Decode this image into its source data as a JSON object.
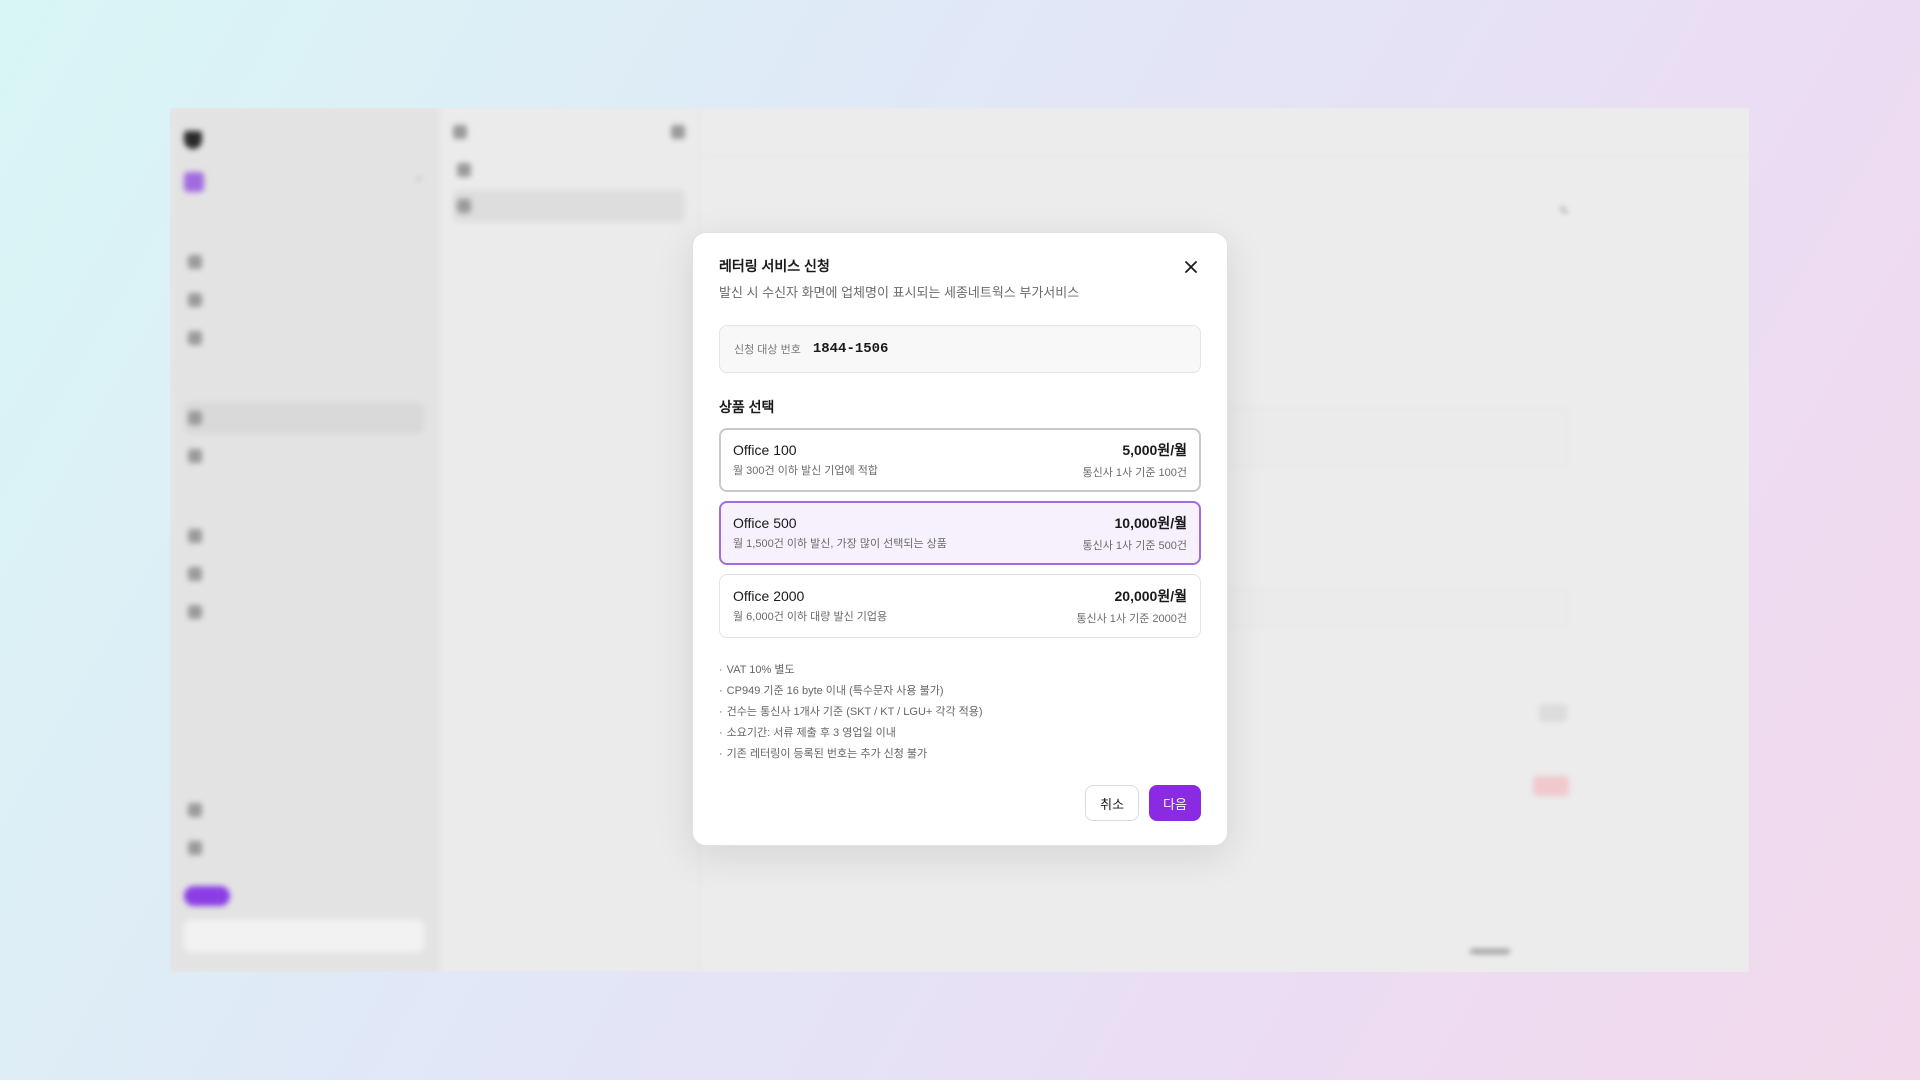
{
  "modal": {
    "title": "레터링 서비스 신청",
    "subtitle": "발신 시 수신자 화면에 업체명이 표시되는 세종네트웍스 부가서비스",
    "close_icon": "close-icon",
    "target_label": "신청 대상 번호",
    "target_number": "1844-1506",
    "section_title": "상품 선택",
    "plans": [
      {
        "name": "Office 100",
        "desc": "월 300건 이하 발신 기업에 적합",
        "price": "5,000원/월",
        "quota": "통신사 1사 기준 100건",
        "state": "focused"
      },
      {
        "name": "Office 500",
        "desc": "월 1,500건 이하 발신, 가장 많이 선택되는 상품",
        "price": "10,000원/월",
        "quota": "통신사 1사 기준 500건",
        "state": "selected"
      },
      {
        "name": "Office 2000",
        "desc": "월 6,000건 이하 대량 발신 기업용",
        "price": "20,000원/월",
        "quota": "통신사 1사 기준 2000건",
        "state": "default"
      }
    ],
    "notes": [
      "VAT 10% 별도",
      "CP949 기준 16 byte 이내 (특수문자 사용 불가)",
      "건수는 통신사 1개사 기준 (SKT / KT / LGU+ 각각 적용)",
      "소요기간: 서류 제출 후 3 영업일 이내",
      "기존 레터링이 등록된 번호는 추가 신청 불가"
    ],
    "cancel_label": "취소",
    "next_label": "다음"
  },
  "colors": {
    "accent": "#8a2be2",
    "selected_border": "#a26be0",
    "selected_bg": "#f7f1fd"
  }
}
